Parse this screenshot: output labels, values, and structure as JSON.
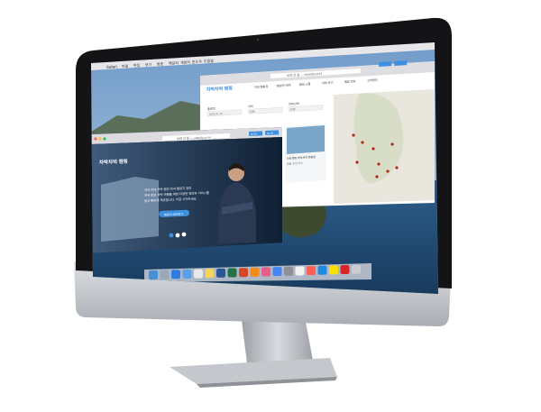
{
  "menubar": {
    "apple": "",
    "app": "Safari",
    "items": [
      "파일",
      "편집",
      "보기",
      "방문",
      "책갈피",
      "개발자",
      "윈도우",
      "도움말"
    ]
  },
  "back_window": {
    "url": "보관 안 됨 — chanda.co.kr",
    "logo": "차박차박 캠핑",
    "nav": [
      "차박 캠핑장",
      "캠핑카 대여",
      "캠핑 소품",
      "차박 후기",
      "캠핑 정보",
      "고객센터"
    ],
    "right_buttons": [
      "관리자",
      "로그인"
    ],
    "filters": [
      {
        "label": "출발일",
        "value": "2021.01.10"
      },
      {
        "label": "지역",
        "value": "전체"
      },
      {
        "label": "지역선택",
        "value": "전체"
      }
    ],
    "card_title": "차박캠핑 차박차박 캠핑장",
    "card_sub": "캠핑 추천 코스"
  },
  "front_window": {
    "url": "보관 안 됨 — chanda.co.kr",
    "buttons": [
      "관리자",
      "로그인"
    ],
    "logo": "차박차박 캠핑",
    "hero_lines": [
      "국내 최대 차박 캠핑 전국 캠핑지 정보",
      "여유 로운 차박 여행을 위한 다양한 정보와 서비스를",
      "쉽고 빠르게 제공합니다. 지금 시작하세요"
    ],
    "cta": "캠핑카 예약하기"
  },
  "colors": {
    "accent": "#3d8fe0",
    "bezel": "#1a1a1c",
    "chin": "#c9ccd1",
    "stand": "#b7bbc0"
  },
  "dock_icons": [
    "finder-icon",
    "launchpad-icon",
    "safari-icon",
    "mail-icon",
    "calendar-icon",
    "notes-icon",
    "word-icon",
    "excel-icon",
    "powerpoint-icon",
    "vlc-icon",
    "photos-icon",
    "chrome-icon",
    "settings-icon",
    "preview-icon",
    "calendar2-icon",
    "appstore-icon",
    "kakaotalk-icon",
    "acrobat-icon",
    "trash-icon"
  ]
}
